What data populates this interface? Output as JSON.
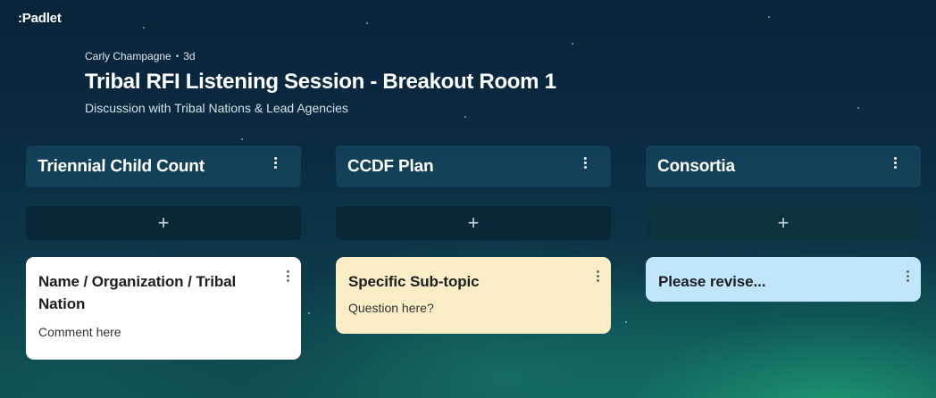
{
  "app": {
    "logo": ":Padlet"
  },
  "header": {
    "author": "Carly Champagne",
    "separator": "•",
    "age": "3d",
    "title": "Tribal RFI Listening Session - Breakout Room 1",
    "subtitle": "Discussion with Tribal Nations & Lead Agencies"
  },
  "columns": [
    {
      "title": "Triennial Child Count",
      "add_label": "+",
      "posts": [
        {
          "title": "Name / Organization / Tribal Nation",
          "body": "Comment here",
          "color": "#ffffff"
        }
      ]
    },
    {
      "title": "CCDF Plan",
      "add_label": "+",
      "posts": [
        {
          "title": "Specific Sub-topic",
          "body": "Question here?",
          "color": "#fbeec6"
        }
      ]
    },
    {
      "title": "Consortia",
      "add_label": "+",
      "posts": [
        {
          "title": "Please revise...",
          "body": "",
          "color": "#bfe6fb"
        }
      ]
    }
  ],
  "icons": {
    "more": "more-vertical-icon",
    "add": "plus-icon"
  }
}
